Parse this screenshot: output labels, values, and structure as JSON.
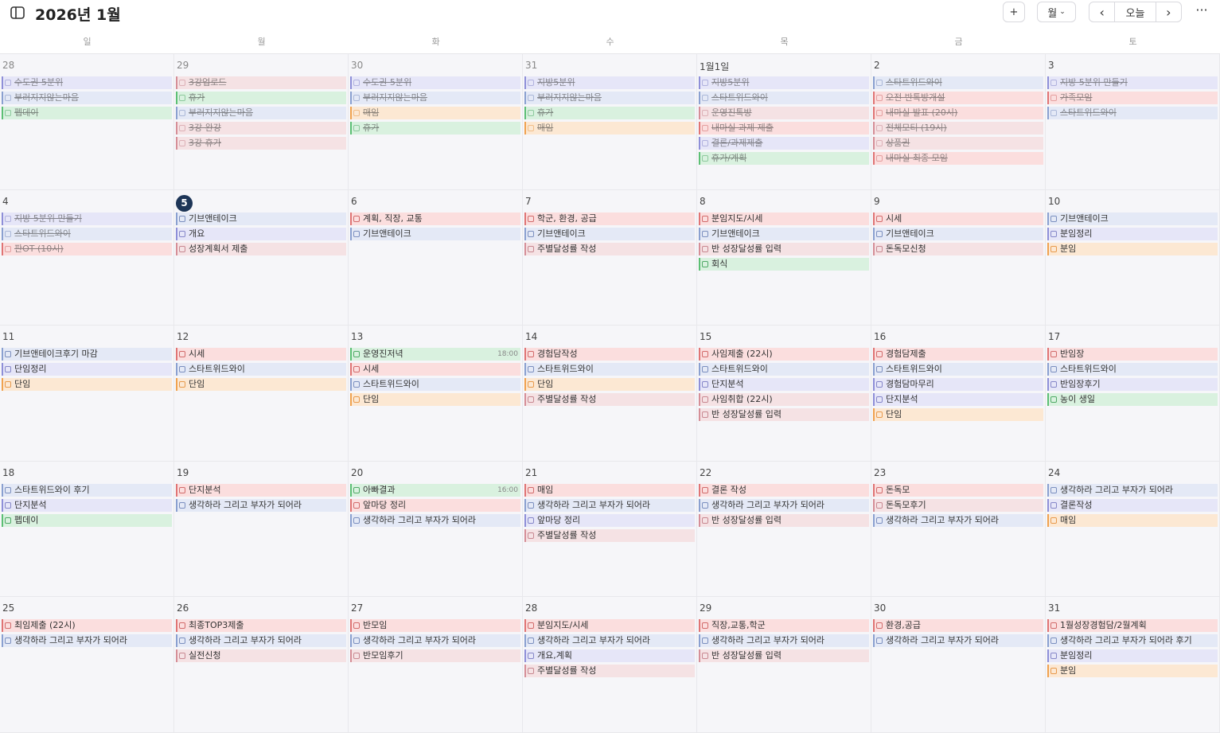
{
  "header": {
    "title": "2026년 1월",
    "add_label": "+",
    "view_label": "월",
    "today_label": "오늘",
    "prev_label": "‹",
    "next_label": "›",
    "more_label": "···",
    "icons": {
      "sidebar": "sidebar-toggle-icon",
      "add": "plus-icon",
      "view": "chevron-down-icon",
      "prev": "chevron-left-icon",
      "next": "chevron-right-icon",
      "more": "more-icon"
    }
  },
  "weekdays": [
    "일",
    "월",
    "화",
    "수",
    "목",
    "금",
    "토"
  ],
  "colors": {
    "blue": "#e4e9f6",
    "red": "#fbdede",
    "green": "#d9f1df",
    "pink": "#f5e2e4",
    "orange": "#fce8d3",
    "purple": "#e6e6f8",
    "today_badge": "#1d3557"
  },
  "weeks": [
    [
      {
        "day": "28",
        "prev": true,
        "events": [
          {
            "t": "수도권 5분위",
            "c": "purple",
            "d": true
          },
          {
            "t": "부러지지않는마음",
            "c": "blue",
            "d": true
          },
          {
            "t": "펩데이",
            "c": "green",
            "d": true
          }
        ]
      },
      {
        "day": "29",
        "prev": true,
        "events": [
          {
            "t": "3강업로드",
            "c": "pink",
            "d": true
          },
          {
            "t": "휴가",
            "c": "green",
            "d": true
          },
          {
            "t": "부러지지않는마음",
            "c": "blue",
            "d": true
          },
          {
            "t": "3강 완강",
            "c": "pink",
            "d": true
          },
          {
            "t": "3강 휴가",
            "c": "pink",
            "d": true
          }
        ]
      },
      {
        "day": "30",
        "prev": true,
        "events": [
          {
            "t": "수도권 5분위",
            "c": "purple",
            "d": true
          },
          {
            "t": "부러지지않는마음",
            "c": "blue",
            "d": true
          },
          {
            "t": "매임",
            "c": "orange",
            "d": true
          },
          {
            "t": "휴가",
            "c": "green",
            "d": true
          }
        ]
      },
      {
        "day": "31",
        "prev": true,
        "events": [
          {
            "t": "지방5분위",
            "c": "purple",
            "d": true
          },
          {
            "t": "부러지지않는마음",
            "c": "blue",
            "d": true
          },
          {
            "t": "휴가",
            "c": "green",
            "d": true
          },
          {
            "t": "매임",
            "c": "orange",
            "d": true
          }
        ]
      },
      {
        "day": "1월1일",
        "events": [
          {
            "t": "지방5분위",
            "c": "purple",
            "d": true
          },
          {
            "t": "스타트위드와이",
            "c": "blue",
            "d": true
          },
          {
            "t": "운영진톡방",
            "c": "pink",
            "d": true
          },
          {
            "t": "내마실 과제 제출",
            "c": "red",
            "d": true
          },
          {
            "t": "결론/과제제출",
            "c": "purple",
            "d": true
          },
          {
            "t": "휴가/계획",
            "c": "green",
            "d": true
          }
        ]
      },
      {
        "day": "2",
        "events": [
          {
            "t": "스타트위드와이",
            "c": "blue",
            "d": true
          },
          {
            "t": "오전 반톡방개설",
            "c": "red",
            "d": true
          },
          {
            "t": "내마실 발표 (20시)",
            "c": "red",
            "d": true
          },
          {
            "t": "전체모티 (19시)",
            "c": "pink",
            "d": true
          },
          {
            "t": "상품권",
            "c": "pink",
            "d": true
          },
          {
            "t": "내마실 최종 모임",
            "c": "red",
            "d": true
          }
        ]
      },
      {
        "day": "3",
        "events": [
          {
            "t": "지방 5분위 만들기",
            "c": "purple",
            "d": true
          },
          {
            "t": "가족모임",
            "c": "red",
            "d": true
          },
          {
            "t": "스타트위드와이",
            "c": "blue",
            "d": true
          }
        ]
      }
    ],
    [
      {
        "day": "4",
        "events": [
          {
            "t": "지방 5분위 만들기",
            "c": "purple",
            "d": true
          },
          {
            "t": "스타트위드와이",
            "c": "blue",
            "d": true
          },
          {
            "t": "판OT (10시)",
            "c": "red",
            "d": true
          }
        ]
      },
      {
        "day": "5",
        "today": true,
        "events": [
          {
            "t": "기브앤테이크",
            "c": "blue"
          },
          {
            "t": "개요",
            "c": "purple"
          },
          {
            "t": "성장계획서 제출",
            "c": "pink"
          }
        ]
      },
      {
        "day": "6",
        "events": [
          {
            "t": "계획, 직장, 교통",
            "c": "red"
          },
          {
            "t": "기브앤테이크",
            "c": "blue"
          }
        ]
      },
      {
        "day": "7",
        "events": [
          {
            "t": "학군, 환경, 공급",
            "c": "red"
          },
          {
            "t": "기브앤테이크",
            "c": "blue"
          },
          {
            "t": "주별달성률 작성",
            "c": "pink"
          }
        ]
      },
      {
        "day": "8",
        "events": [
          {
            "t": "분임지도/시세",
            "c": "red"
          },
          {
            "t": "기브앤테이크",
            "c": "blue"
          },
          {
            "t": "반 성장달성률 입력",
            "c": "pink"
          },
          {
            "t": "회식",
            "c": "green"
          }
        ]
      },
      {
        "day": "9",
        "events": [
          {
            "t": "시세",
            "c": "red"
          },
          {
            "t": "기브앤테이크",
            "c": "blue"
          },
          {
            "t": "돈독모신청",
            "c": "pink"
          }
        ]
      },
      {
        "day": "10",
        "events": [
          {
            "t": "기브앤테이크",
            "c": "blue"
          },
          {
            "t": "분임정리",
            "c": "purple"
          },
          {
            "t": "분임",
            "c": "orange"
          }
        ]
      }
    ],
    [
      {
        "day": "11",
        "events": [
          {
            "t": "기브앤테이크후기 마감",
            "c": "blue"
          },
          {
            "t": "단임정리",
            "c": "purple"
          },
          {
            "t": "단임",
            "c": "orange"
          }
        ]
      },
      {
        "day": "12",
        "events": [
          {
            "t": "시세",
            "c": "red"
          },
          {
            "t": "스타트위드와이",
            "c": "blue"
          },
          {
            "t": "단임",
            "c": "orange"
          }
        ]
      },
      {
        "day": "13",
        "events": [
          {
            "t": "운영진저녁",
            "c": "green",
            "time": "18:00"
          },
          {
            "t": "시세",
            "c": "red"
          },
          {
            "t": "스타트위드와이",
            "c": "blue"
          },
          {
            "t": "단임",
            "c": "orange"
          }
        ]
      },
      {
        "day": "14",
        "events": [
          {
            "t": "경험담작성",
            "c": "red"
          },
          {
            "t": "스타트위드와이",
            "c": "blue"
          },
          {
            "t": "단임",
            "c": "orange"
          },
          {
            "t": "주별달성률 작성",
            "c": "pink"
          }
        ]
      },
      {
        "day": "15",
        "events": [
          {
            "t": "사임제출 (22시)",
            "c": "red"
          },
          {
            "t": "스타트위드와이",
            "c": "blue"
          },
          {
            "t": "단지분석",
            "c": "purple"
          },
          {
            "t": "사임취합 (22시)",
            "c": "pink"
          },
          {
            "t": "반 성장달성률 입력",
            "c": "pink"
          }
        ]
      },
      {
        "day": "16",
        "events": [
          {
            "t": "경험담제출",
            "c": "red"
          },
          {
            "t": "스타트위드와이",
            "c": "blue"
          },
          {
            "t": "경험담마무리",
            "c": "purple"
          },
          {
            "t": "단지분석",
            "c": "purple"
          },
          {
            "t": "단임",
            "c": "orange"
          }
        ]
      },
      {
        "day": "17",
        "events": [
          {
            "t": "반임장",
            "c": "red"
          },
          {
            "t": "스타트위드와이",
            "c": "blue"
          },
          {
            "t": "반임장후기",
            "c": "purple"
          },
          {
            "t": "농이 생일",
            "c": "green"
          }
        ]
      }
    ],
    [
      {
        "day": "18",
        "events": [
          {
            "t": "스타트위드와이 후기",
            "c": "blue"
          },
          {
            "t": "단지분석",
            "c": "purple"
          },
          {
            "t": "펩데이",
            "c": "green"
          }
        ]
      },
      {
        "day": "19",
        "events": [
          {
            "t": "단지분석",
            "c": "red"
          },
          {
            "t": "생각하라 그리고 부자가 되어라",
            "c": "blue"
          }
        ]
      },
      {
        "day": "20",
        "events": [
          {
            "t": "아빠결과",
            "c": "green",
            "time": "16:00"
          },
          {
            "t": "앞마당 정리",
            "c": "red"
          },
          {
            "t": "생각하라 그리고 부자가 되어라",
            "c": "blue"
          }
        ]
      },
      {
        "day": "21",
        "events": [
          {
            "t": "매임",
            "c": "red"
          },
          {
            "t": "생각하라 그리고 부자가 되어라",
            "c": "blue"
          },
          {
            "t": "앞마당 정리",
            "c": "purple"
          },
          {
            "t": "주별달성률 작성",
            "c": "pink"
          }
        ]
      },
      {
        "day": "22",
        "events": [
          {
            "t": "결론 작성",
            "c": "red"
          },
          {
            "t": "생각하라 그리고 부자가 되어라",
            "c": "blue"
          },
          {
            "t": "반 성장달성률 입력",
            "c": "pink"
          }
        ]
      },
      {
        "day": "23",
        "events": [
          {
            "t": "돈독모",
            "c": "red"
          },
          {
            "t": "돈독모후기",
            "c": "pink"
          },
          {
            "t": "생각하라 그리고 부자가 되어라",
            "c": "blue"
          }
        ]
      },
      {
        "day": "24",
        "events": [
          {
            "t": "생각하라 그리고 부자가 되어라",
            "c": "blue"
          },
          {
            "t": "결론작성",
            "c": "purple"
          },
          {
            "t": "매임",
            "c": "orange"
          }
        ]
      }
    ],
    [
      {
        "day": "25",
        "events": [
          {
            "t": "최임제출 (22시)",
            "c": "red"
          },
          {
            "t": "생각하라 그리고 부자가 되어라",
            "c": "blue"
          }
        ]
      },
      {
        "day": "26",
        "events": [
          {
            "t": "최종TOP3제출",
            "c": "red"
          },
          {
            "t": "생각하라 그리고 부자가 되어라",
            "c": "blue"
          },
          {
            "t": "실전신청",
            "c": "pink"
          }
        ]
      },
      {
        "day": "27",
        "events": [
          {
            "t": "반모임",
            "c": "red"
          },
          {
            "t": "생각하라 그리고 부자가 되어라",
            "c": "blue"
          },
          {
            "t": "반모임후기",
            "c": "pink"
          }
        ]
      },
      {
        "day": "28",
        "events": [
          {
            "t": "분임지도/시세",
            "c": "red"
          },
          {
            "t": "생각하라 그리고 부자가 되어라",
            "c": "blue"
          },
          {
            "t": "개요,계획",
            "c": "purple"
          },
          {
            "t": "주별달성률 작성",
            "c": "pink"
          }
        ]
      },
      {
        "day": "29",
        "events": [
          {
            "t": "직장,교통,학군",
            "c": "red"
          },
          {
            "t": "생각하라 그리고 부자가 되어라",
            "c": "blue"
          },
          {
            "t": "반 성장달성률 입력",
            "c": "pink"
          }
        ]
      },
      {
        "day": "30",
        "events": [
          {
            "t": "환경,공급",
            "c": "red"
          },
          {
            "t": "생각하라 그리고 부자가 되어라",
            "c": "blue"
          }
        ]
      },
      {
        "day": "31",
        "events": [
          {
            "t": "1월성장경험담/2월계획",
            "c": "red"
          },
          {
            "t": "생각하라 그리고 부자가 되어라 후기",
            "c": "blue"
          },
          {
            "t": "분임정리",
            "c": "purple"
          },
          {
            "t": "분임",
            "c": "orange"
          }
        ]
      }
    ]
  ]
}
